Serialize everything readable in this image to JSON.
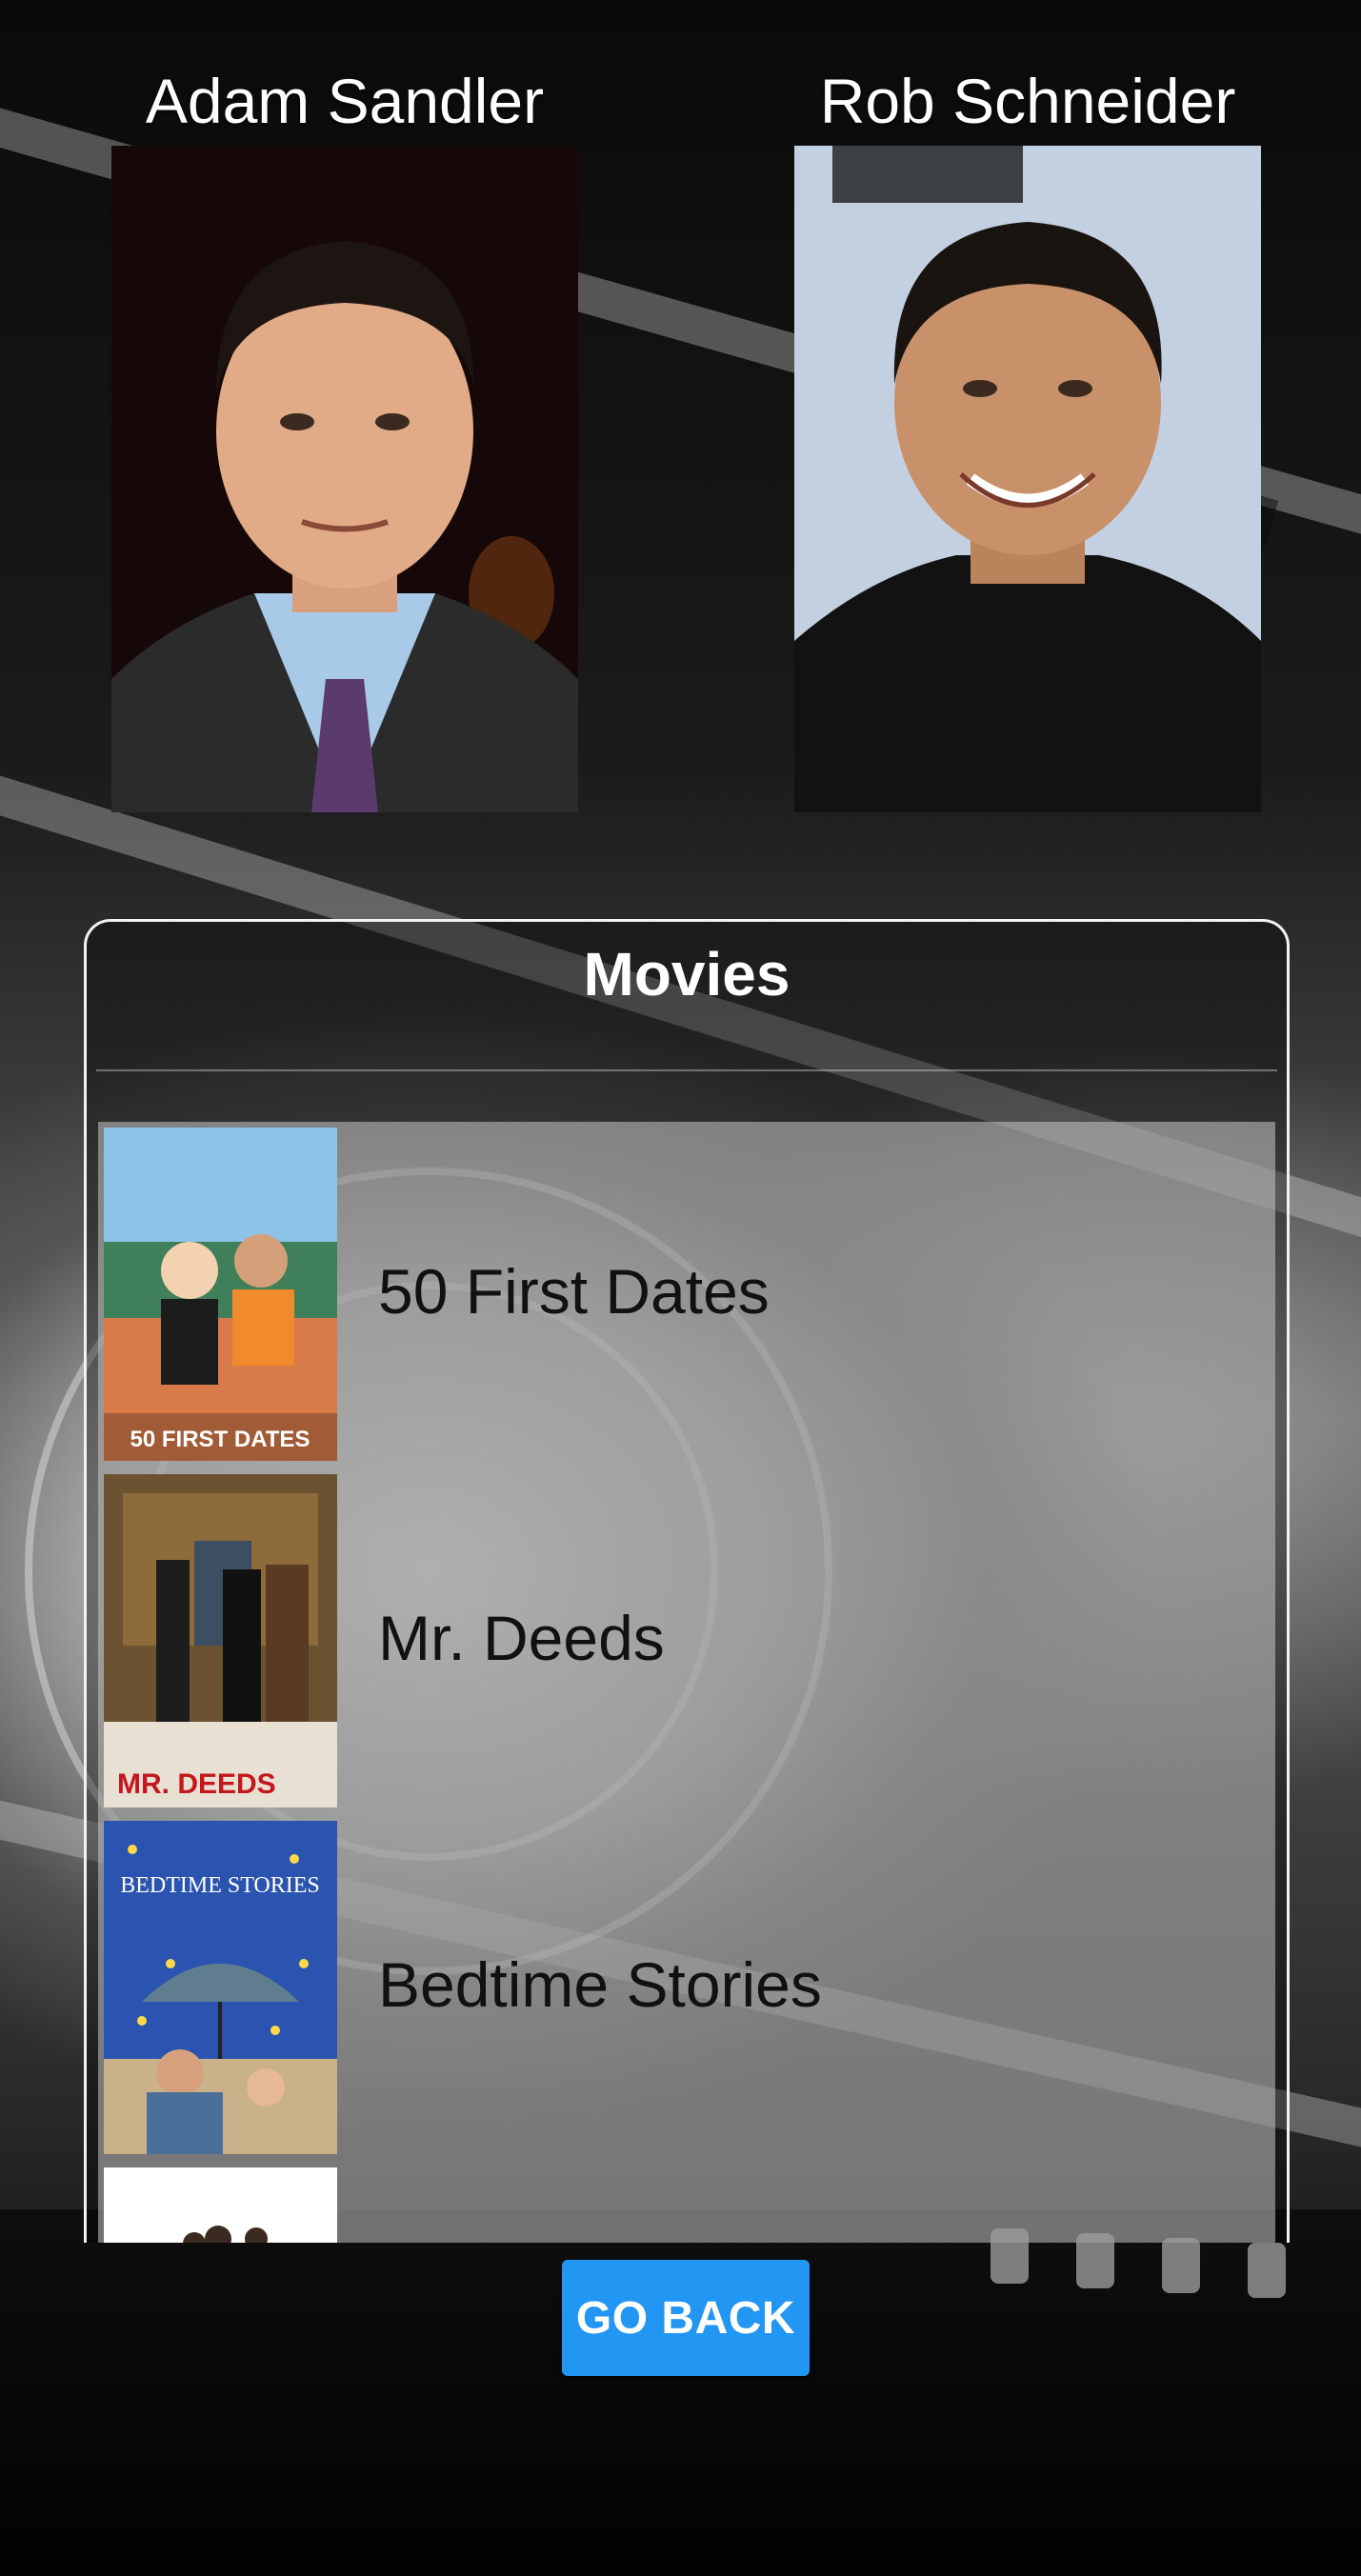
{
  "actors": [
    {
      "name": "Adam Sandler"
    },
    {
      "name": "Rob Schneider"
    }
  ],
  "movies_panel": {
    "title": "Movies",
    "items": [
      {
        "title": "50 First Dates",
        "poster_text": "50 FIRST DATES"
      },
      {
        "title": "Mr. Deeds",
        "poster_text": "MR. DEEDS"
      },
      {
        "title": "Bedtime Stories",
        "poster_text": "BEDTIME STORIES"
      },
      {
        "title": ""
      }
    ]
  },
  "buttons": {
    "go_back": "GO BACK"
  },
  "colors": {
    "button": "#2196f3",
    "panel_border": "#f2f2f2"
  }
}
